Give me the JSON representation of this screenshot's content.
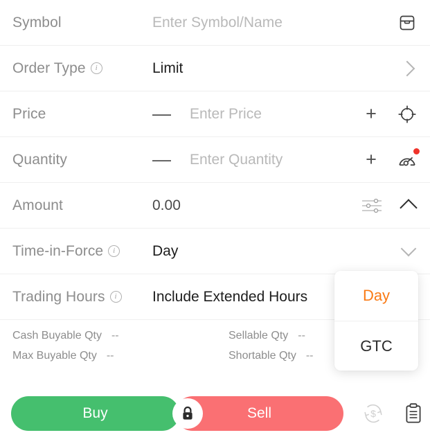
{
  "rows": {
    "symbol": {
      "label": "Symbol",
      "placeholder": "Enter Symbol/Name",
      "value": "",
      "icon": "archive-box-icon"
    },
    "order_type": {
      "label": "Order Type",
      "value": "Limit",
      "info": "i",
      "chevron": "chevron-right-icon"
    },
    "price": {
      "label": "Price",
      "placeholder": "Enter Price",
      "value": "",
      "minus": "—",
      "plus": "+",
      "icon": "crosshair-target-icon"
    },
    "quantity": {
      "label": "Quantity",
      "placeholder": "Enter Quantity",
      "value": "",
      "minus": "—",
      "plus": "+",
      "icon": "gauge-icon",
      "badge": true
    },
    "amount": {
      "label": "Amount",
      "value": "0.00",
      "icon": "sliders-icon",
      "chevron": "chevron-up-icon"
    },
    "time_in_force": {
      "label": "Time-in-Force",
      "value": "Day",
      "info": "i",
      "chevron": "chevron-down-icon"
    },
    "trading_hours": {
      "label": "Trading Hours",
      "value": "Include Extended Hours",
      "info": "i"
    }
  },
  "stats": [
    {
      "label": "Cash Buyable Qty",
      "value": "--"
    },
    {
      "label": "Sellable Qty",
      "value": "--"
    },
    {
      "label": "Max Buyable Qty",
      "value": "--"
    },
    {
      "label": "Shortable Qty",
      "value": "--"
    }
  ],
  "actions": {
    "buy_label": "Buy",
    "sell_label": "Sell",
    "lock_icon": "lock-icon",
    "currency_refresh_icon": "currency-refresh-icon",
    "order_list_icon": "clipboard-order-icon"
  },
  "tif_dropdown": {
    "open": true,
    "options": [
      {
        "label": "Day",
        "selected": true
      },
      {
        "label": "GTC",
        "selected": false
      }
    ]
  },
  "colors": {
    "buy_green": "#45bf6e",
    "sell_red": "#fa7073",
    "accent_orange": "#fa7a14",
    "badge_red": "#f0342b",
    "label_gray": "#8d8d8d",
    "placeholder_gray": "#b9b9b9",
    "value_dark": "#1d1d1d",
    "divider": "#efefef"
  }
}
